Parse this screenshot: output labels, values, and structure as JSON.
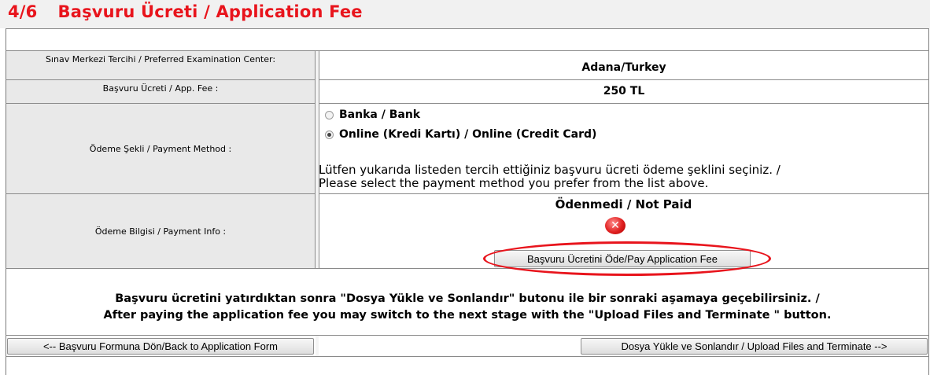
{
  "header": {
    "step": "4/6",
    "title": "Başvuru Ücreti / Application Fee"
  },
  "rows": {
    "exam_center": {
      "label": "Sınav Merkezi Tercihi / Preferred Examination Center:",
      "value": "Adana/Turkey"
    },
    "fee": {
      "label": "Başvuru Ücreti / App. Fee :",
      "value": "250 TL"
    },
    "payment_method": {
      "label": "Ödeme Şekli / Payment Method :",
      "options": [
        {
          "label": "Banka / Bank",
          "selected": false
        },
        {
          "label": "Online (Kredi Kartı) / Online (Credit Card)",
          "selected": true
        }
      ],
      "note_line1": "Lütfen yukarıda listeden tercih ettiğiniz başvuru ücreti ödeme şeklini seçiniz. /",
      "note_line2": "Please select the payment method you prefer from the list above."
    },
    "payment_info": {
      "label": "Ödeme Bilgisi / Payment Info :",
      "status": "Ödenmedi / Not Paid",
      "status_icon": "x-circle-icon",
      "pay_button": "Başvuru Ücretini Öde/Pay Application Fee"
    }
  },
  "message": {
    "line1": "Başvuru ücretini yatırdıktan sonra \"Dosya Yükle ve Sonlandır\" butonu ile bir sonraki aşamaya geçebilirsiniz. /",
    "line2": "After paying the application fee you may switch to the next stage with the \"Upload Files and Terminate \" button."
  },
  "nav": {
    "back_button": "<-- Başvuru Formuna Dön/Back to Application Form",
    "next_button": "Dosya Yükle ve Sonlandır / Upload Files and Terminate -->"
  },
  "colors": {
    "accent": "#e8141c",
    "label_bg": "#e9e9e9",
    "header_bg": "#f1f1f1"
  }
}
